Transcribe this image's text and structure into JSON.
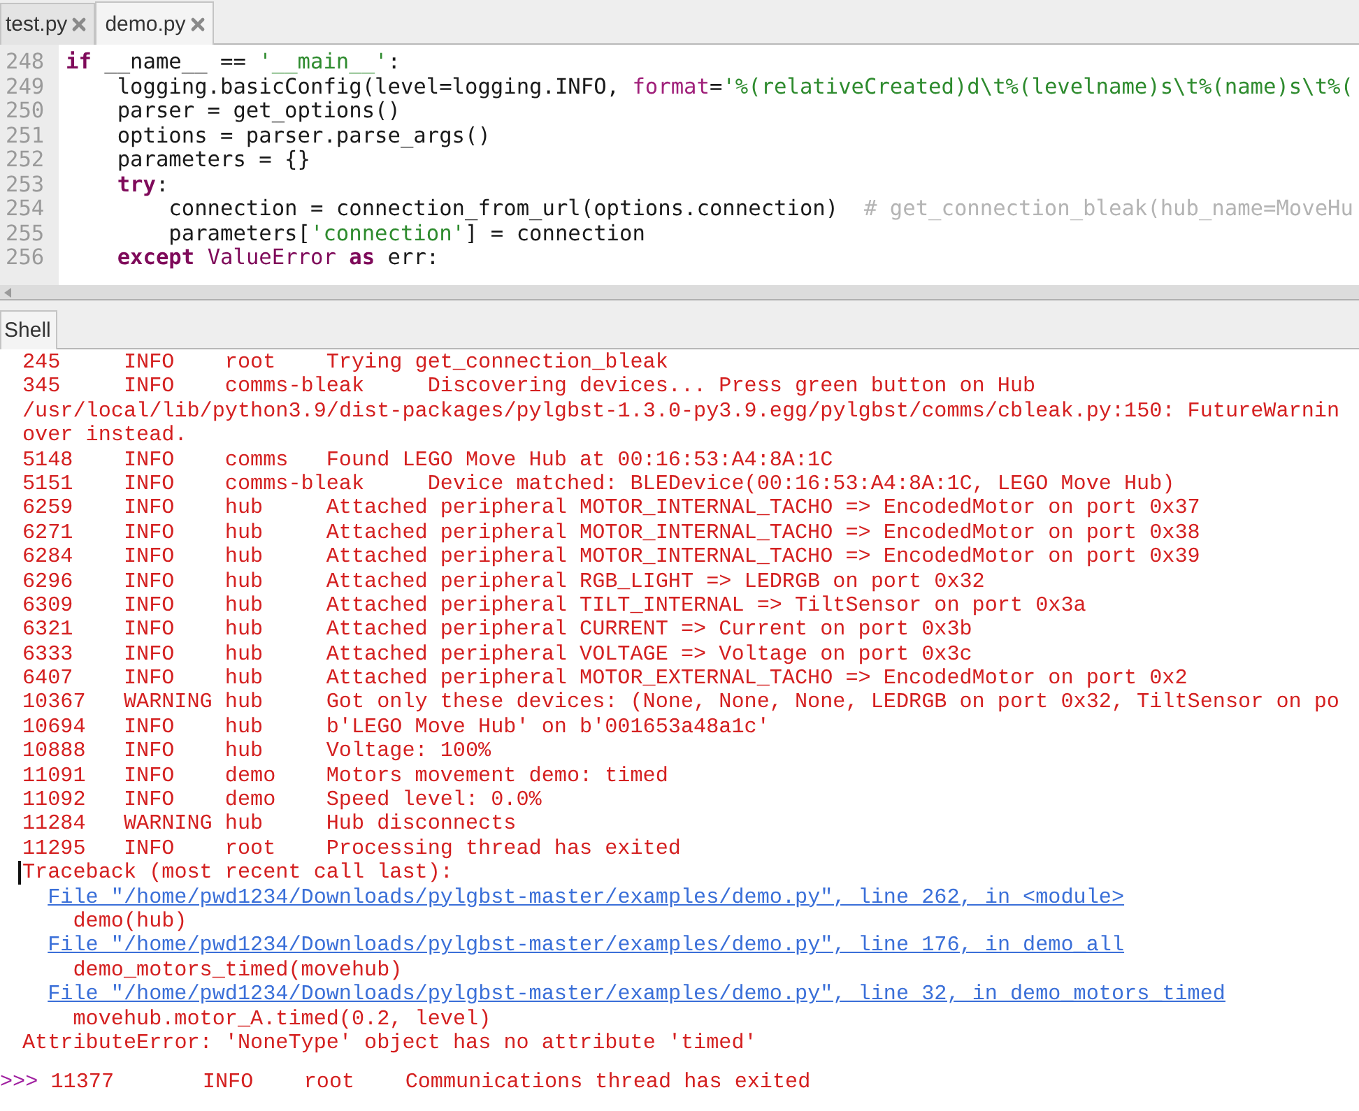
{
  "editor_tabs": [
    {
      "label": "test.py",
      "selected": false
    },
    {
      "label": "demo.py",
      "selected": true
    }
  ],
  "editor": {
    "lines": [
      {
        "number": "248",
        "tokens": [
          {
            "kind": "keyword",
            "text": "if"
          },
          {
            "kind": "plain",
            "text": " __name__ == "
          },
          {
            "kind": "string",
            "text": "'__main__'"
          },
          {
            "kind": "plain",
            "text": ":"
          }
        ]
      },
      {
        "number": "249",
        "tokens": [
          {
            "kind": "plain",
            "text": "    logging.basicConfig(level=logging.INFO, "
          },
          {
            "kind": "param",
            "text": "format"
          },
          {
            "kind": "plain",
            "text": "="
          },
          {
            "kind": "string",
            "text": "'%(relativeCreated)d\\t%(levelname)s\\t%(name)s\\t%("
          }
        ]
      },
      {
        "number": "250",
        "tokens": [
          {
            "kind": "plain",
            "text": "    parser = get_options()"
          }
        ]
      },
      {
        "number": "251",
        "tokens": [
          {
            "kind": "plain",
            "text": "    options = parser.parse_args()"
          }
        ]
      },
      {
        "number": "252",
        "tokens": [
          {
            "kind": "plain",
            "text": "    parameters = {}"
          }
        ]
      },
      {
        "number": "253",
        "tokens": [
          {
            "kind": "keyword",
            "text": "    try"
          },
          {
            "kind": "plain",
            "text": ":"
          }
        ]
      },
      {
        "number": "254",
        "tokens": [
          {
            "kind": "plain",
            "text": "        connection = connection_from_url(options.connection)  "
          },
          {
            "kind": "comment",
            "text": "# get_connection_bleak(hub_name=MoveHu"
          }
        ]
      },
      {
        "number": "255",
        "tokens": [
          {
            "kind": "plain",
            "text": "        parameters["
          },
          {
            "kind": "string",
            "text": "'connection'"
          },
          {
            "kind": "plain",
            "text": "] = connection"
          }
        ]
      },
      {
        "number": "256",
        "tokens": [
          {
            "kind": "keyword",
            "text": "    except"
          },
          {
            "kind": "builtin",
            "text": " ValueError"
          },
          {
            "kind": "keyword",
            "text": " as"
          },
          {
            "kind": "plain",
            "text": " err:"
          }
        ]
      }
    ]
  },
  "shell": {
    "tab": "Shell",
    "lines": [
      {
        "kind": "log",
        "time": "245",
        "level": "INFO",
        "logger": "root",
        "message": "Trying get_connection_bleak"
      },
      {
        "kind": "log",
        "time": "345",
        "level": "INFO",
        "logger": "comms-bleak",
        "message": "Discovering devices... Press green button on Hub"
      },
      {
        "kind": "error",
        "text": "/usr/local/lib/python3.9/dist-packages/pylgbst-1.3.0-py3.9.egg/pylgbst/comms/cbleak.py:150: FutureWarnin",
        "caret": false
      },
      {
        "kind": "error",
        "text": "over instead.",
        "caret": false
      },
      {
        "kind": "log",
        "time": "5148",
        "level": "INFO",
        "logger": "comms",
        "message": "Found LEGO Move Hub at 00:16:53:A4:8A:1C"
      },
      {
        "kind": "log",
        "time": "5151",
        "level": "INFO",
        "logger": "comms-bleak",
        "message": "Device matched: BLEDevice(00:16:53:A4:8A:1C, LEGO Move Hub)"
      },
      {
        "kind": "log",
        "time": "6259",
        "level": "INFO",
        "logger": "hub",
        "message": "Attached peripheral MOTOR_INTERNAL_TACHO => EncodedMotor on port 0x37"
      },
      {
        "kind": "log",
        "time": "6271",
        "level": "INFO",
        "logger": "hub",
        "message": "Attached peripheral MOTOR_INTERNAL_TACHO => EncodedMotor on port 0x38"
      },
      {
        "kind": "log",
        "time": "6284",
        "level": "INFO",
        "logger": "hub",
        "message": "Attached peripheral MOTOR_INTERNAL_TACHO => EncodedMotor on port 0x39"
      },
      {
        "kind": "log",
        "time": "6296",
        "level": "INFO",
        "logger": "hub",
        "message": "Attached peripheral RGB_LIGHT => LEDRGB on port 0x32"
      },
      {
        "kind": "log",
        "time": "6309",
        "level": "INFO",
        "logger": "hub",
        "message": "Attached peripheral TILT_INTERNAL => TiltSensor on port 0x3a"
      },
      {
        "kind": "log",
        "time": "6321",
        "level": "INFO",
        "logger": "hub",
        "message": "Attached peripheral CURRENT => Current on port 0x3b"
      },
      {
        "kind": "log",
        "time": "6333",
        "level": "INFO",
        "logger": "hub",
        "message": "Attached peripheral VOLTAGE => Voltage on port 0x3c"
      },
      {
        "kind": "log",
        "time": "6407",
        "level": "INFO",
        "logger": "hub",
        "message": "Attached peripheral MOTOR_EXTERNAL_TACHO => EncodedMotor on port 0x2"
      },
      {
        "kind": "log",
        "time": "10367",
        "level": "WARNING",
        "logger": "hub",
        "message": "Got only these devices: (None, None, None, LEDRGB on port 0x32, TiltSensor on po"
      },
      {
        "kind": "log",
        "time": "10694",
        "level": "INFO",
        "logger": "hub",
        "message": "b'LEGO Move Hub' on b'001653a48a1c'"
      },
      {
        "kind": "log",
        "time": "10888",
        "level": "INFO",
        "logger": "hub",
        "message": "Voltage: 100%"
      },
      {
        "kind": "log",
        "time": "11091",
        "level": "INFO",
        "logger": "demo",
        "message": "Motors movement demo: timed"
      },
      {
        "kind": "log",
        "time": "11092",
        "level": "INFO",
        "logger": "demo",
        "message": "Speed level: 0.0%"
      },
      {
        "kind": "log",
        "time": "11284",
        "level": "WARNING",
        "logger": "hub",
        "message": "Hub disconnects"
      },
      {
        "kind": "log",
        "time": "11295",
        "level": "INFO",
        "logger": "root",
        "message": "Processing thread has exited"
      },
      {
        "kind": "error",
        "text": "Traceback (most recent call last):",
        "caret": true
      },
      {
        "kind": "link",
        "text": "File \"/home/pwd1234/Downloads/pylgbst-master/examples/demo.py\", line 262, in <module>"
      },
      {
        "kind": "source",
        "text": "demo(hub)"
      },
      {
        "kind": "link",
        "text": "File \"/home/pwd1234/Downloads/pylgbst-master/examples/demo.py\", line 176, in demo_all"
      },
      {
        "kind": "source",
        "text": "demo_motors_timed(movehub)"
      },
      {
        "kind": "link",
        "text": "File \"/home/pwd1234/Downloads/pylgbst-master/examples/demo.py\", line 32, in demo_motors_timed"
      },
      {
        "kind": "source",
        "text": "movehub.motor_A.timed(0.2, level)"
      },
      {
        "kind": "error",
        "text": "AttributeError: 'NoneType' object has no attribute 'timed'",
        "caret": false
      },
      {
        "kind": "prompt",
        "prompt": ">>>",
        "time": "11377",
        "level": "INFO",
        "logger": "root",
        "message": "Communications thread has exited"
      }
    ]
  }
}
